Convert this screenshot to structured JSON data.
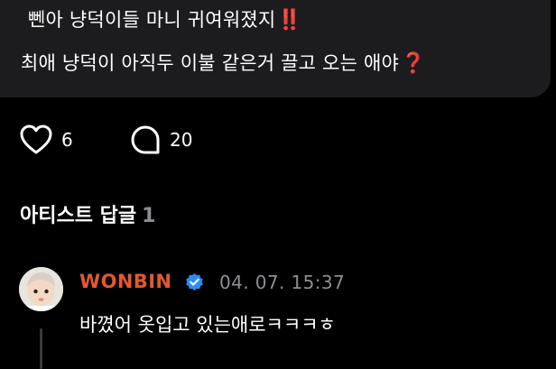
{
  "post": {
    "line1": "뻰아 냥덕이들 마니 귀여워졌지",
    "line1_emoji": "‼️",
    "line2": "최애 냥덕이 아직두 이불 같은거 끌고 오는 애야",
    "line2_emoji": "❓"
  },
  "actions": {
    "like_count": "6",
    "comment_count": "20"
  },
  "replies_section": {
    "title": "아티스트 답글",
    "count": "1"
  },
  "reply": {
    "author": "WONBIN",
    "timestamp": "04. 07. 15:37",
    "text": "바꼈어 옷입고 있는애로ㅋㅋㅋㅎ"
  },
  "colors": {
    "background": "#000000",
    "bubble": "#1c1c1e",
    "artist_name": "#e4582f",
    "muted": "#8e8e93",
    "verified": "#2d8cf0",
    "emoji_red": "#e0192a"
  },
  "icons": {
    "like": "heart-outline-icon",
    "comment": "speech-bubble-outline-icon",
    "verified": "verified-badge-icon"
  }
}
